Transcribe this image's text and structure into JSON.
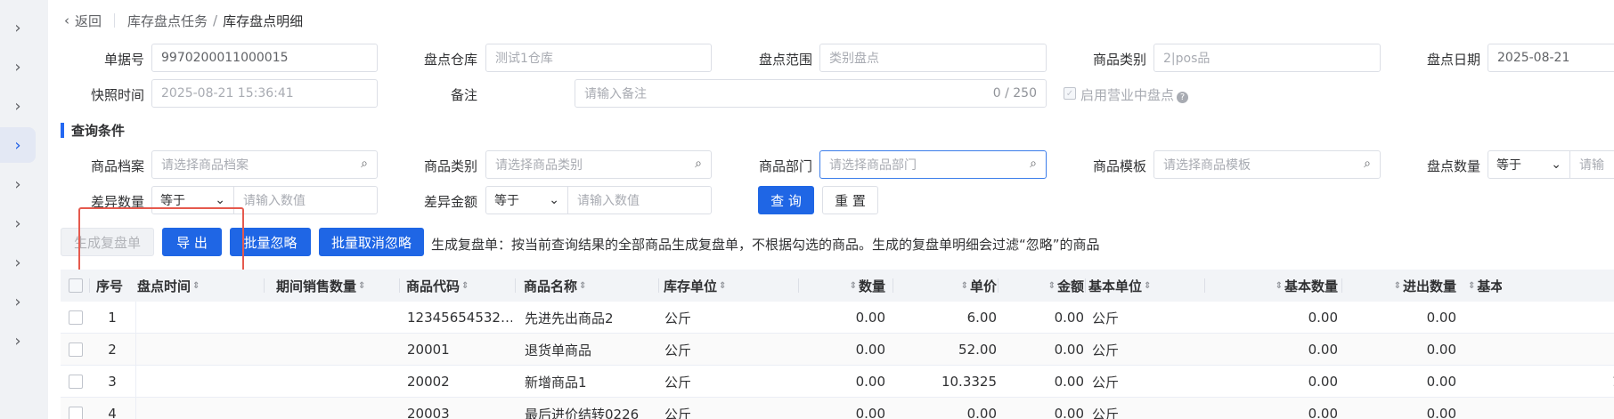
{
  "breadcrumb": {
    "back": "返回",
    "parent": "库存盘点任务",
    "separator": "/",
    "current": "库存盘点明细"
  },
  "header_form": {
    "doc_no": {
      "label": "单据号",
      "value": "9970200011000015"
    },
    "warehouse": {
      "label": "盘点仓库",
      "value": "测试1仓库"
    },
    "scope": {
      "label": "盘点范围",
      "value": "类别盘点"
    },
    "category": {
      "label": "商品类别",
      "value": "2|pos品"
    },
    "date": {
      "label": "盘点日期",
      "value": "2025-08-21"
    },
    "snapshot": {
      "label": "快照时间",
      "value": "2025-08-21 15:36:41"
    },
    "remark": {
      "label": "备注",
      "placeholder": "请输入备注",
      "counter": "0 / 250"
    },
    "in_business": {
      "label": "启用营业中盘点",
      "checked": true,
      "help": "?"
    }
  },
  "query": {
    "section_title": "查询条件",
    "product_archive": {
      "label": "商品档案",
      "placeholder": "请选择商品档案"
    },
    "product_category": {
      "label": "商品类别",
      "placeholder": "请选择商品类别"
    },
    "product_dept": {
      "label": "商品部门",
      "placeholder": "请选择商品部门"
    },
    "product_template": {
      "label": "商品模板",
      "placeholder": "请选择商品模板"
    },
    "count_qty": {
      "label": "盘点数量",
      "operator": "等于",
      "placeholder": "请输"
    },
    "diff_qty": {
      "label": "差异数量",
      "operator": "等于",
      "placeholder": "请输入数值"
    },
    "diff_amount": {
      "label": "差异金额",
      "operator": "等于",
      "placeholder": "请输入数值"
    },
    "search_label": "查 询",
    "reset_label": "重 置"
  },
  "toolbar": {
    "generate_recheck": "生成复盘单",
    "export": "导 出",
    "batch_ignore": "批量忽略",
    "batch_cancel_ignore": "批量取消忽略",
    "hint": "生成复盘单：按当前查询结果的全部商品生成复盘单，不根据勾选的商品。生成的复盘单明细会过滤“忽略”的商品"
  },
  "table": {
    "columns": [
      "序号",
      "盘点时间",
      "期间销售数量",
      "商品代码",
      "商品名称",
      "库存单位",
      "数量",
      "单价",
      "金额",
      "基本单位",
      "基本数量",
      "进出数量",
      "基本"
    ],
    "rows": [
      {
        "index": "1",
        "time": "",
        "sales": "",
        "code": "12345654532…",
        "name": "先进先出商品2",
        "unit": "公斤",
        "qty": "0.00",
        "price": "6.00",
        "amount": "0.00",
        "base_unit": "公斤",
        "base_qty": "0.00",
        "io_qty": "0.00",
        "extra": ""
      },
      {
        "index": "2",
        "time": "",
        "sales": "",
        "code": "20001",
        "name": "退货单商品",
        "unit": "公斤",
        "qty": "0.00",
        "price": "52.00",
        "amount": "0.00",
        "base_unit": "公斤",
        "base_qty": "0.00",
        "io_qty": "0.00",
        "extra": ""
      },
      {
        "index": "3",
        "time": "",
        "sales": "",
        "code": "20002",
        "name": "新增商品1",
        "unit": "公斤",
        "qty": "0.00",
        "price": "10.3325",
        "amount": "0.00",
        "base_unit": "公斤",
        "base_qty": "0.00",
        "io_qty": "0.00",
        "extra": "1"
      },
      {
        "index": "4",
        "time": "",
        "sales": "",
        "code": "20003",
        "name": "最后进价结转0226",
        "unit": "公斤",
        "qty": "0.00",
        "price": "0.00",
        "amount": "0.00",
        "base_unit": "公斤",
        "base_qty": "0.00",
        "io_qty": "0.00",
        "extra": ""
      }
    ]
  },
  "icons": {
    "rail_chevron": "chevron-right-icon",
    "back": "chevron-left-icon",
    "search": "search-icon",
    "dropdown": "chevron-down-icon",
    "sort": "sort-icon"
  },
  "colors": {
    "primary": "#1f66e5",
    "highlight_frame": "#e55a4e",
    "section_accent": "#2468f2"
  }
}
